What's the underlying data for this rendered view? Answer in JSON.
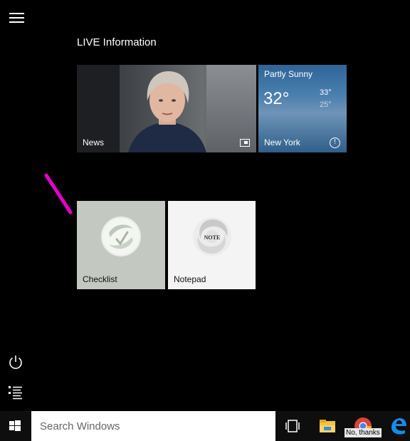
{
  "start": {
    "group_title": "LIVE Information",
    "tiles": {
      "news": {
        "label": "News"
      },
      "weather": {
        "condition": "Partly Sunny",
        "temperature": "32°",
        "high": "33°",
        "low": "25°",
        "location": "New York"
      },
      "checklist": {
        "label": "Checklist"
      },
      "notepad": {
        "label": "Notepad",
        "logo_text": "NOTE"
      }
    }
  },
  "taskbar": {
    "search_placeholder": "Search Windows",
    "popup_text": "No, thanks"
  },
  "colors": {
    "weather_tile": "#3d6f9f",
    "checklist_tile": "#c3c9c0",
    "notepad_tile": "#f4f4f4",
    "annotation_stroke": "#e600c8"
  }
}
